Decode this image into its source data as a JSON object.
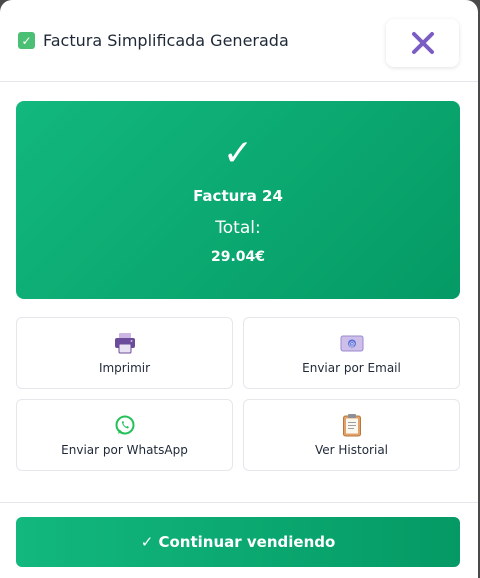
{
  "header": {
    "title": "Factura Simplificada Generada",
    "check_glyph": "✓",
    "close_icon": "close-icon"
  },
  "success": {
    "check_glyph": "✓",
    "invoice_label": "Factura 24",
    "total_label": "Total:",
    "total_value": "29.04€"
  },
  "actions": [
    {
      "label": "Imprimir",
      "icon": "printer-icon"
    },
    {
      "label": "Enviar por Email",
      "icon": "email-icon"
    },
    {
      "label": "Enviar por WhatsApp",
      "icon": "whatsapp-icon"
    },
    {
      "label": "Ver Historial",
      "icon": "clipboard-icon"
    }
  ],
  "footer": {
    "continue_label": "✓ Continuar vendiendo"
  },
  "colors": {
    "accent": "#10b27a",
    "close_purple": "#7b5cc4",
    "check_green": "#4bbf73"
  }
}
